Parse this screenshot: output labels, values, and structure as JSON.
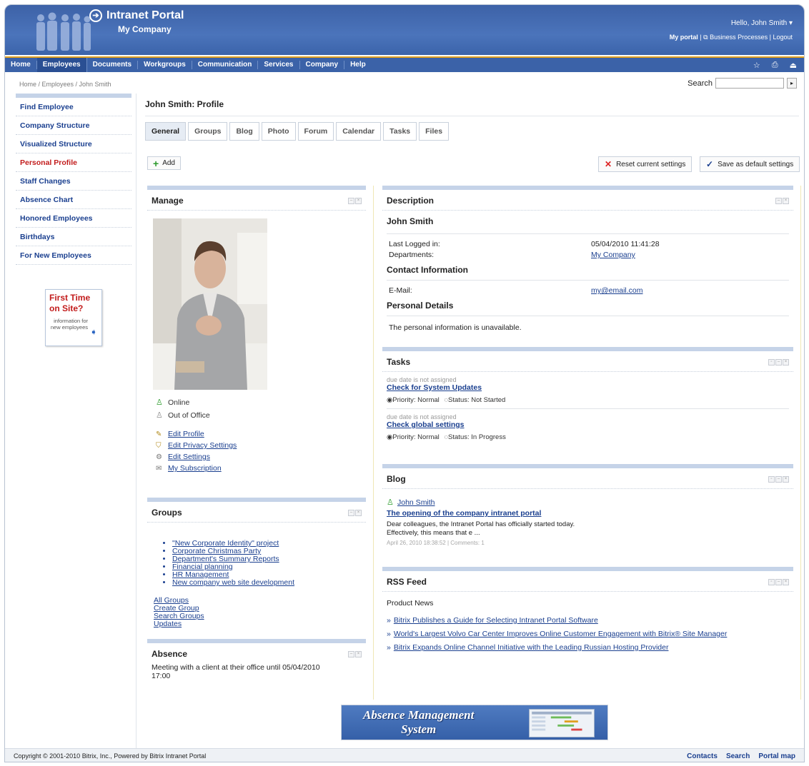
{
  "header": {
    "app_title": "Intranet Portal",
    "company": "My Company",
    "greeting": "Hello, John Smith",
    "my_portal": "My portal",
    "business_processes": "Business Processes",
    "logout": "Logout"
  },
  "menu": {
    "items": [
      "Home",
      "Employees",
      "Documents",
      "Workgroups",
      "Communication",
      "Services",
      "Company",
      "Help"
    ],
    "active": "Employees"
  },
  "breadcrumb": "Home / Employees / John Smith",
  "search": {
    "label": "Search",
    "value": ""
  },
  "sidebar": {
    "items": [
      "Find Employee",
      "Company Structure",
      "Visualized Structure",
      "Personal Profile",
      "Staff Changes",
      "Absence Chart",
      "Honored Employees",
      "Birthdays",
      "For New Employees"
    ],
    "active": "Personal Profile",
    "first_time": {
      "line1": "First Time",
      "line2": "on Site?",
      "info": "information for new employees"
    }
  },
  "page": {
    "title": "John Smith: Profile",
    "tabs": [
      "General",
      "Groups",
      "Blog",
      "Photo",
      "Forum",
      "Calendar",
      "Tasks",
      "Files"
    ],
    "active_tab": "General",
    "add_label": "Add",
    "reset_label": "Reset current settings",
    "save_label": "Save as default settings"
  },
  "manage": {
    "title": "Manage",
    "status_online": "Online",
    "status_out": "Out of Office",
    "actions": [
      "Edit Profile",
      "Edit Privacy Settings",
      "Edit Settings",
      "My Subscription"
    ]
  },
  "groups": {
    "title": "Groups",
    "items": [
      "\"New Corporate Identity\" project",
      "Corporate Christmas Party",
      "Department's Summary Reports",
      "Financial planning",
      "HR Management",
      "New company web site development"
    ],
    "links": [
      "All Groups",
      "Create Group",
      "Search Groups",
      "Updates"
    ]
  },
  "absence": {
    "title": "Absence",
    "text": "Meeting with a client at their office until 05/04/2010 17:00"
  },
  "description": {
    "title": "Description",
    "name": "John Smith",
    "last_logged_label": "Last Logged in:",
    "last_logged_value": "05/04/2010 11:41:28",
    "departments_label": "Departments:",
    "departments_value": "My Company",
    "contact_title": "Contact Information",
    "email_label": "E-Mail:",
    "email_value": "my@email.com",
    "personal_title": "Personal Details",
    "personal_text": "The personal information is unavailable."
  },
  "tasks": {
    "title": "Tasks",
    "items": [
      {
        "due": "due date is not assigned",
        "name": "Check for System Updates",
        "priority": "Priority: Normal",
        "status": "Status: Not Started"
      },
      {
        "due": "due date is not assigned",
        "name": "Check global settings",
        "priority": "Priority: Normal",
        "status": "Status: In Progress"
      }
    ]
  },
  "blog": {
    "title": "Blog",
    "author": "John Smith",
    "post_title": "The opening of the company intranet portal",
    "excerpt_line1": "Dear colleagues, the Intranet Portal has officially started today.",
    "excerpt_line2": "Effectively, this means that e ...",
    "meta": "April 26, 2010 18:38:52 | Comments: 1"
  },
  "rss": {
    "title": "RSS Feed",
    "category": "Product News",
    "items": [
      "Bitrix Publishes a Guide for Selecting Intranet Portal Software",
      "World's Largest Volvo Car Center Improves Online Customer Engagement with Bitrix® Site Manager",
      "Bitrix Expands Online Channel Initiative with the Leading Russian Hosting Provider"
    ]
  },
  "banner": {
    "line1": "Absence Management",
    "line2": "System"
  },
  "footer": {
    "copyright": "Copyright © 2001-2010 Bitrix, Inc., Powered by Bitrix Intranet Portal",
    "links": [
      "Contacts",
      "Search",
      "Portal map"
    ]
  },
  "colors": {
    "header_blue": "#4b74bb",
    "menu_blue": "#3b62a8",
    "accent_orange": "#e0a020",
    "link_blue": "#1a3f8f",
    "active_red": "#c21c1c",
    "panel_bar": "#c5d3e8"
  }
}
